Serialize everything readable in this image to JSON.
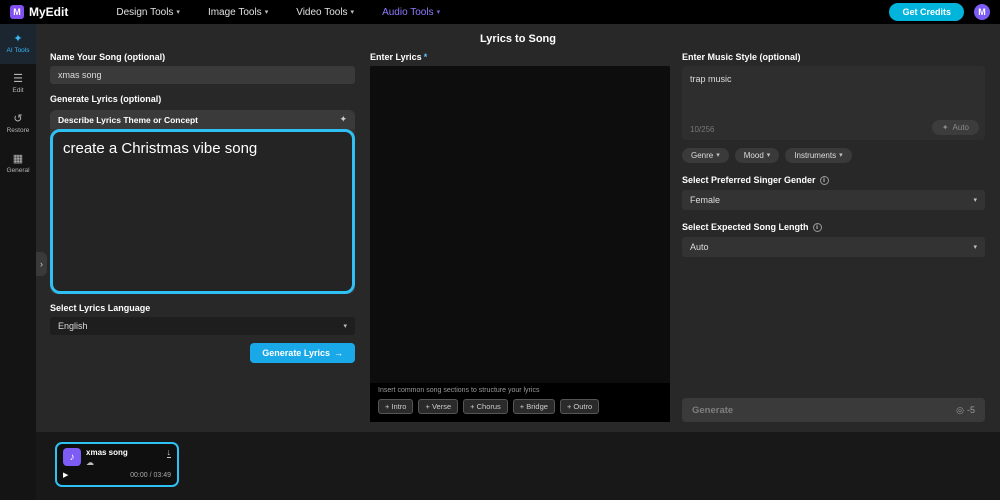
{
  "colors": {
    "accent_cyan": "#2fc0f4",
    "brand_purple": "#8250f2",
    "credits_cyan": "#00b4dc"
  },
  "topbar": {
    "logo_letter": "M",
    "brand": "MyEdit",
    "nav": [
      "Design Tools",
      "Image Tools",
      "Video Tools",
      "Audio Tools"
    ],
    "get_credits_label": "Get Credits",
    "avatar_letter": "M"
  },
  "sidebar": {
    "items": [
      {
        "label": "AI Tools"
      },
      {
        "label": "Edit"
      },
      {
        "label": "Restore"
      },
      {
        "label": "General"
      }
    ]
  },
  "page_title": "Lyrics to Song",
  "left": {
    "name_label": "Name Your Song (optional)",
    "name_value": "xmas song",
    "generate_label": "Generate Lyrics (optional)",
    "describe_header": "Describe Lyrics Theme or Concept",
    "describe_value": "create a Christmas vibe song",
    "language_label": "Select Lyrics Language",
    "language_value": "English",
    "generate_button": "Generate Lyrics"
  },
  "lyrics": {
    "label": "Enter Lyrics",
    "required_mark": "*",
    "helper": "Insert common song sections to structure your lyrics",
    "sections": [
      "+ Intro",
      "+ Verse",
      "+ Chorus",
      "+ Bridge",
      "+ Outro"
    ]
  },
  "style": {
    "label": "Enter Music Style (optional)",
    "value": "trap music",
    "char_count": "10/256",
    "auto_button": "Auto",
    "chips": [
      "Genre",
      "Mood",
      "Instruments"
    ],
    "gender_label": "Select Preferred Singer Gender",
    "gender_value": "Female",
    "length_label": "Select Expected Song Length",
    "length_value": "Auto",
    "generate_button": "Generate",
    "credits_cost": "-5"
  },
  "player": {
    "title": "xmas song",
    "time": "00:00 / 03:49"
  },
  "icons": {
    "chevron_down": "▾",
    "arrow_right": "→",
    "collapse": "›",
    "cloud": "☁",
    "play": "▶",
    "music_note": "♪",
    "download": "↓",
    "info": "i",
    "wand": "✦",
    "ai_tools": "✦",
    "edit": "☰",
    "restore": "↺",
    "general": "▦",
    "coin": "◎"
  }
}
